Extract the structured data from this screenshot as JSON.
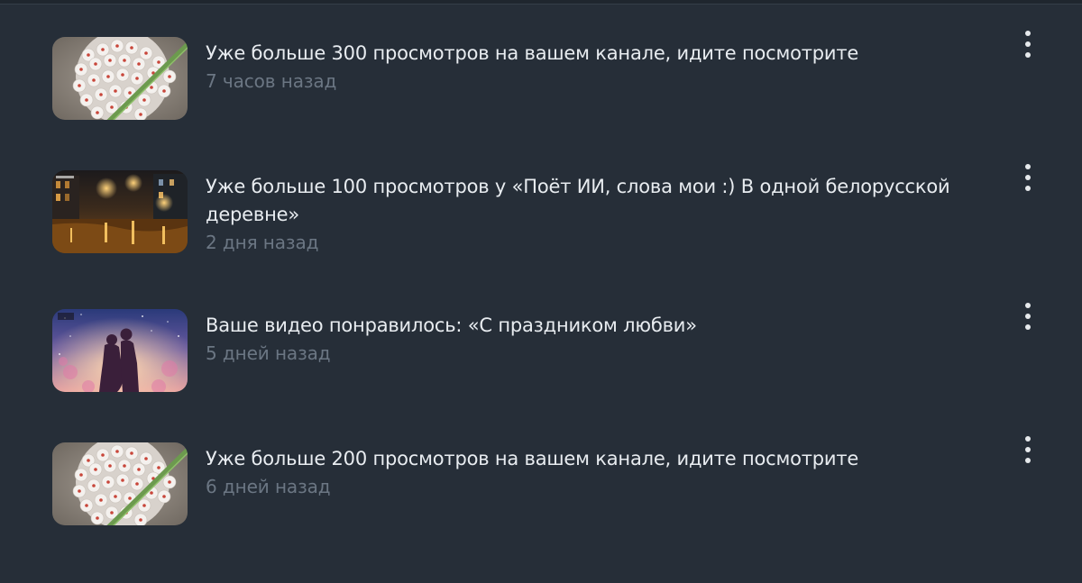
{
  "notifications": [
    {
      "title": "Уже больше 300 просмотров на вашем канале, идите посмотрите",
      "time": "7 часов назад",
      "thumbnail_icon": "flower-ball-thumbnail"
    },
    {
      "title": "Уже больше 100 просмотров у «Поёт ИИ, слова мои :) В одной белорусской деревне»",
      "time": "2 дня назад",
      "thumbnail_icon": "night-street-thumbnail"
    },
    {
      "title": "Ваше видео понравилось: «С праздником любви»",
      "time": "5 дней назад",
      "thumbnail_icon": "couple-silhouette-thumbnail"
    },
    {
      "title": "Уже больше 200 просмотров на вашем канале, идите посмотрите",
      "time": "6 дней назад",
      "thumbnail_icon": "flower-ball-thumbnail"
    }
  ],
  "colors": {
    "background": "#262e38",
    "title_text": "#e8ecf0",
    "time_text": "#6b7683",
    "menu_dots": "#e6e9ec"
  }
}
